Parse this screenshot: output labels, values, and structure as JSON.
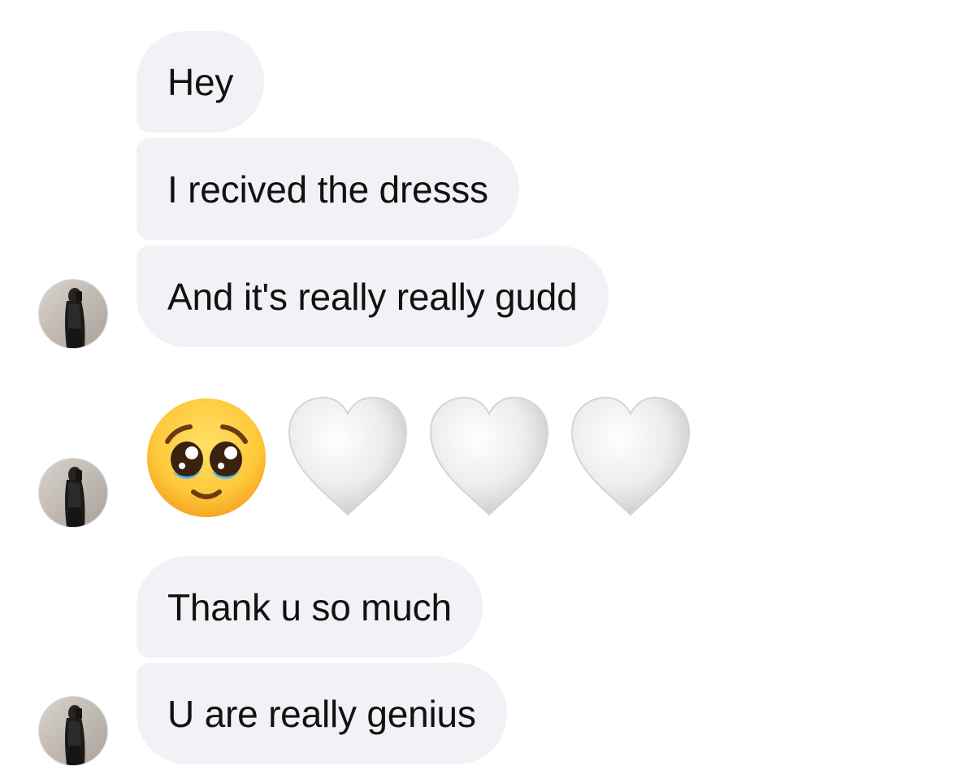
{
  "conversation": {
    "messages": [
      {
        "text": "Hey"
      },
      {
        "text": "I recived the dresss"
      },
      {
        "text": "And it's really really gudd"
      },
      {
        "emojis": [
          "pleading-face",
          "white-heart",
          "white-heart",
          "white-heart"
        ]
      },
      {
        "text": "Thank u so much"
      },
      {
        "text": "U are really genius"
      }
    ]
  },
  "colors": {
    "bubble_background": "#f1f2f5",
    "text": "#111111",
    "background": "#ffffff"
  }
}
